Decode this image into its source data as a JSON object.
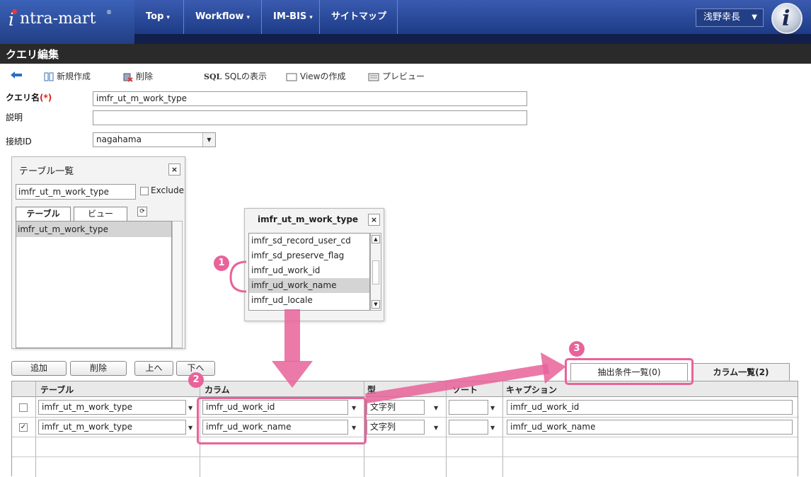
{
  "header": {
    "logo_i": "i",
    "logo_text": "ntra-mart",
    "logo_reg": "®",
    "nav": [
      {
        "label": "Top",
        "has_caret": true
      },
      {
        "label": "Workflow",
        "has_caret": true
      },
      {
        "label": "IM-BIS",
        "has_caret": true
      },
      {
        "label": "サイトマップ",
        "has_caret": false
      }
    ],
    "caret": "▾",
    "user_name": "浅野幸長",
    "user_caret": "▼",
    "badge_letter": "i"
  },
  "page_title": "クエリ編集",
  "toolbar": {
    "back_icon": "back-arrow-icon",
    "new_label": "新規作成",
    "delete_label": "削除",
    "sql_prefix": "SQL",
    "sql_label": "SQLの表示",
    "view_label": "Viewの作成",
    "preview_label": "プレビュー"
  },
  "form": {
    "query_name_label": "クエリ名",
    "required_mark": "(*)",
    "query_name_value": "imfr_ut_m_work_type",
    "description_label": "説明",
    "description_value": "",
    "connection_label": "接続ID",
    "connection_value": "nagahama",
    "select_arrow": "▼"
  },
  "table_panel": {
    "title": "テーブル一覧",
    "close": "×",
    "filter_value": "imfr_ut_m_work_type",
    "exclude_label": "Exclude",
    "exclude_checked": false,
    "tab_table": "テーブル",
    "tab_view": "ビュー",
    "refresh_icon": "refresh-icon",
    "items": [
      "imfr_ut_m_work_type"
    ]
  },
  "column_popup": {
    "title": "imfr_ut_m_work_type",
    "close": "×",
    "items": [
      "imfr_sd_record_user_cd",
      "imfr_sd_preserve_flag",
      "imfr_ud_work_id",
      "imfr_ud_work_name",
      "imfr_ud_locale"
    ],
    "selected_index": 3,
    "scroll_up": "▲",
    "scroll_down": "▼"
  },
  "buttons": {
    "add": "追加",
    "delete": "削除",
    "up": "上へ",
    "down": "下へ"
  },
  "tabs": {
    "conditions": "抽出条件一覧(0)",
    "columns": "カラム一覧(2)"
  },
  "grid": {
    "headers": [
      "テーブル",
      "カラム",
      "型",
      "ソート",
      "キャプション"
    ],
    "rows": [
      {
        "checked": false,
        "table": "imfr_ut_m_work_type",
        "column": "imfr_ud_work_id",
        "type": "文字列",
        "sort": "",
        "caption": "imfr_ud_work_id"
      },
      {
        "checked": true,
        "table": "imfr_ut_m_work_type",
        "column": "imfr_ud_work_name",
        "type": "文字列",
        "sort": "",
        "caption": "imfr_ud_work_name"
      }
    ],
    "check_mark": "✓"
  },
  "annotations": {
    "step1": "1",
    "step2": "2",
    "step3": "3",
    "color": "#e8639a"
  },
  "colors": {
    "header_dark": "#121f4a",
    "nav_blue": "#2a4a9e",
    "title_bar": "#2a2a2a"
  }
}
